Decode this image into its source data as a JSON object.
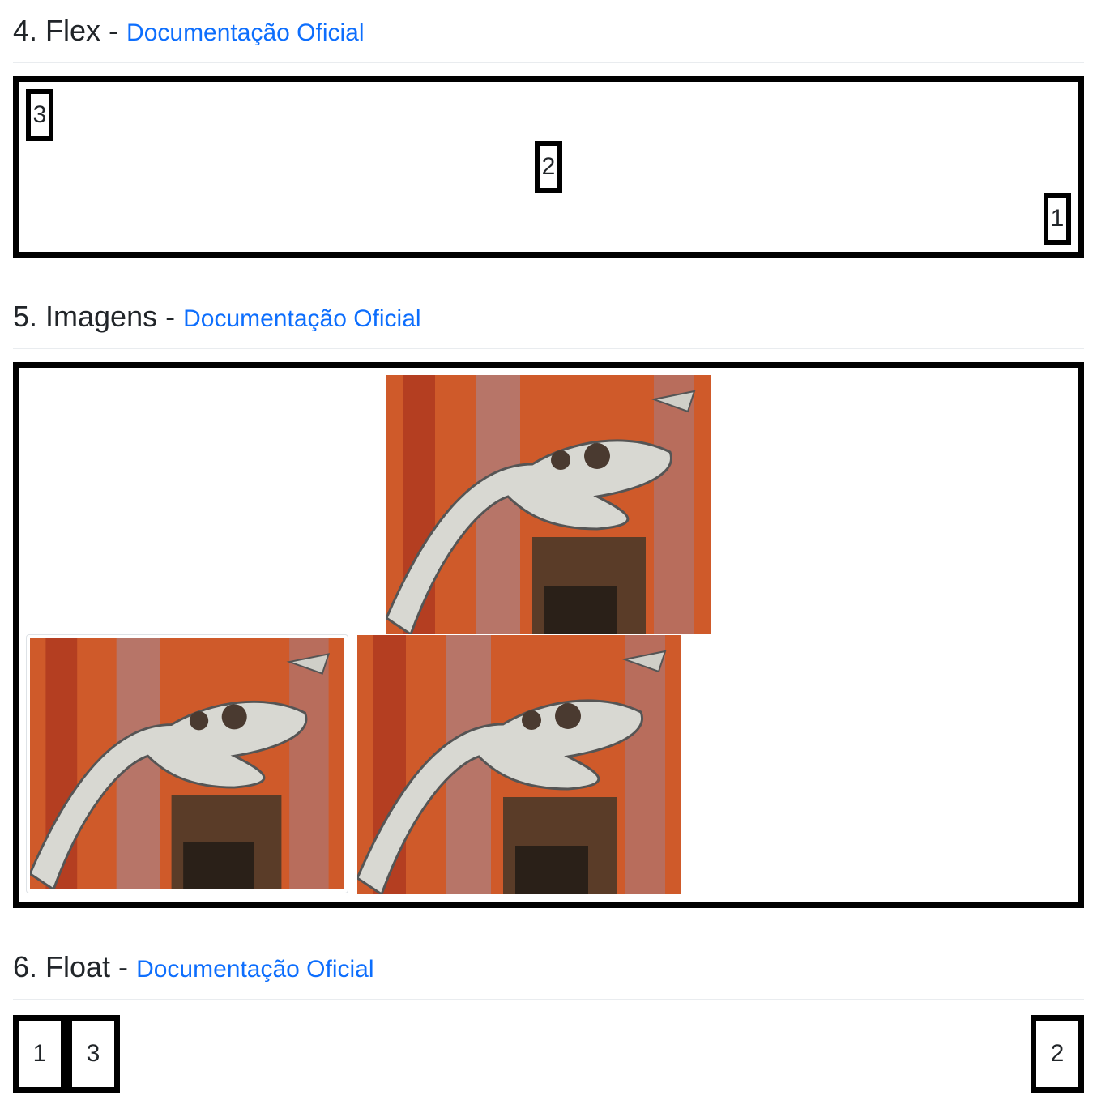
{
  "sections": {
    "flex": {
      "title": "4. Flex - ",
      "link": "Documentação Oficial",
      "items": [
        "1",
        "2",
        "3"
      ]
    },
    "images": {
      "title": "5. Imagens - ",
      "link": "Documentação Oficial"
    },
    "float": {
      "title": "6. Float - ",
      "link": "Documentação Oficial",
      "items": [
        "1",
        "2",
        "3"
      ]
    }
  },
  "colors": {
    "link": "#0d6efd",
    "border": "#000000",
    "text": "#212529"
  }
}
